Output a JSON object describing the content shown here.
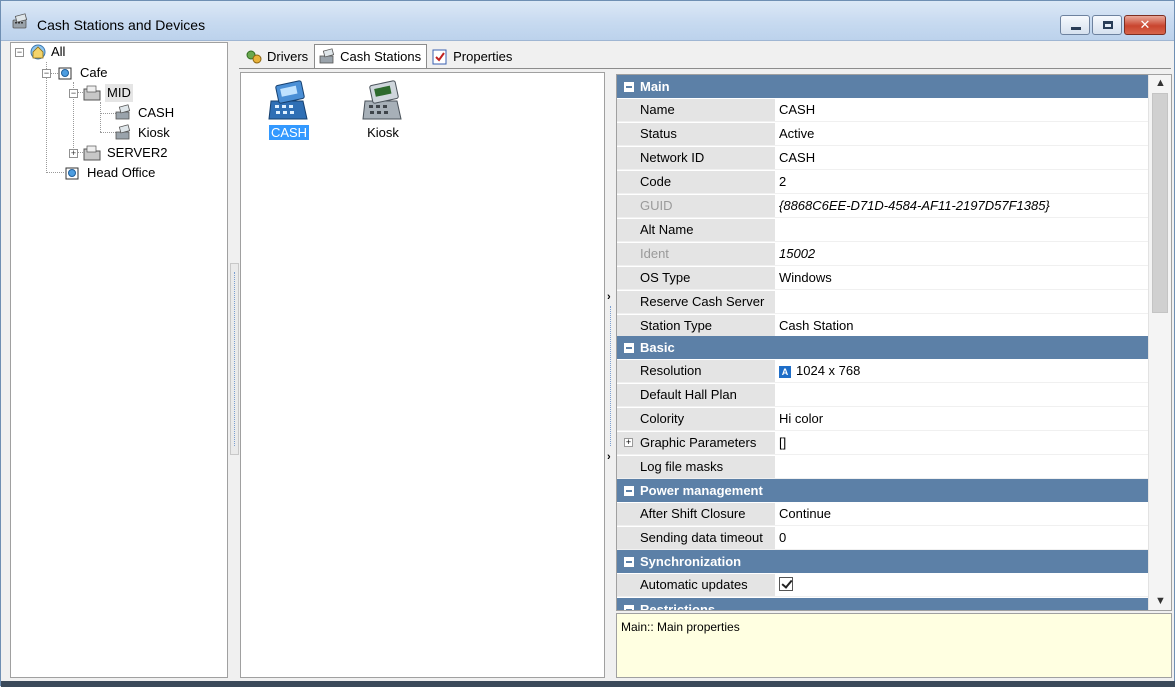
{
  "window": {
    "title": "Cash Stations and Devices"
  },
  "tree": {
    "root": "All",
    "cafe": "Cafe",
    "mid": "MID",
    "cash": "CASH",
    "kiosk": "Kiosk",
    "server2": "SERVER2",
    "head_office": "Head Office"
  },
  "tabs": [
    {
      "label": "Drivers"
    },
    {
      "label": "Cash Stations"
    },
    {
      "label": "Properties"
    }
  ],
  "stations": [
    {
      "label": "CASH",
      "selected": true
    },
    {
      "label": "Kiosk",
      "selected": false
    }
  ],
  "properties": {
    "main": {
      "title": "Main",
      "rows": [
        {
          "name": "Name",
          "value": "CASH"
        },
        {
          "name": "Status",
          "value": "Active"
        },
        {
          "name": "Network ID",
          "value": "CASH"
        },
        {
          "name": "Code",
          "value": "2"
        },
        {
          "name": "GUID",
          "value": "{8868C6EE-D71D-4584-AF11-2197D57F1385}"
        },
        {
          "name": "Alt Name",
          "value": ""
        },
        {
          "name": "Ident",
          "value": "15002"
        },
        {
          "name": "OS Type",
          "value": "Windows"
        },
        {
          "name": "Reserve Cash Server",
          "value": ""
        },
        {
          "name": "Station Type",
          "value": "Cash Station"
        }
      ]
    },
    "basic": {
      "title": "Basic",
      "rows": [
        {
          "name": "Resolution",
          "value": "1024 x 768"
        },
        {
          "name": "Default Hall Plan",
          "value": ""
        },
        {
          "name": "Colority",
          "value": "Hi color"
        },
        {
          "name": "Graphic Parameters",
          "value": "[]"
        },
        {
          "name": "Log file masks",
          "value": ""
        }
      ]
    },
    "power": {
      "title": "Power management",
      "rows": [
        {
          "name": "After Shift Closure",
          "value": "Continue"
        },
        {
          "name": "Sending data timeout",
          "value": "0"
        }
      ]
    },
    "sync": {
      "title": "Synchronization",
      "rows": [
        {
          "name": "Automatic updates",
          "value": ""
        }
      ]
    },
    "restrictions": {
      "title": "Restrictions"
    }
  },
  "help": {
    "text": "Main:: Main properties"
  },
  "colors": {
    "category_bg": "#5c80a7",
    "selection": "#3399ff",
    "help_bg": "#ffffe1"
  },
  "icons": {
    "title": "cash-register-icon",
    "tab_drivers": "drivers-icon",
    "tab_cash": "cash-register-icon",
    "tab_props": "properties-icon"
  }
}
